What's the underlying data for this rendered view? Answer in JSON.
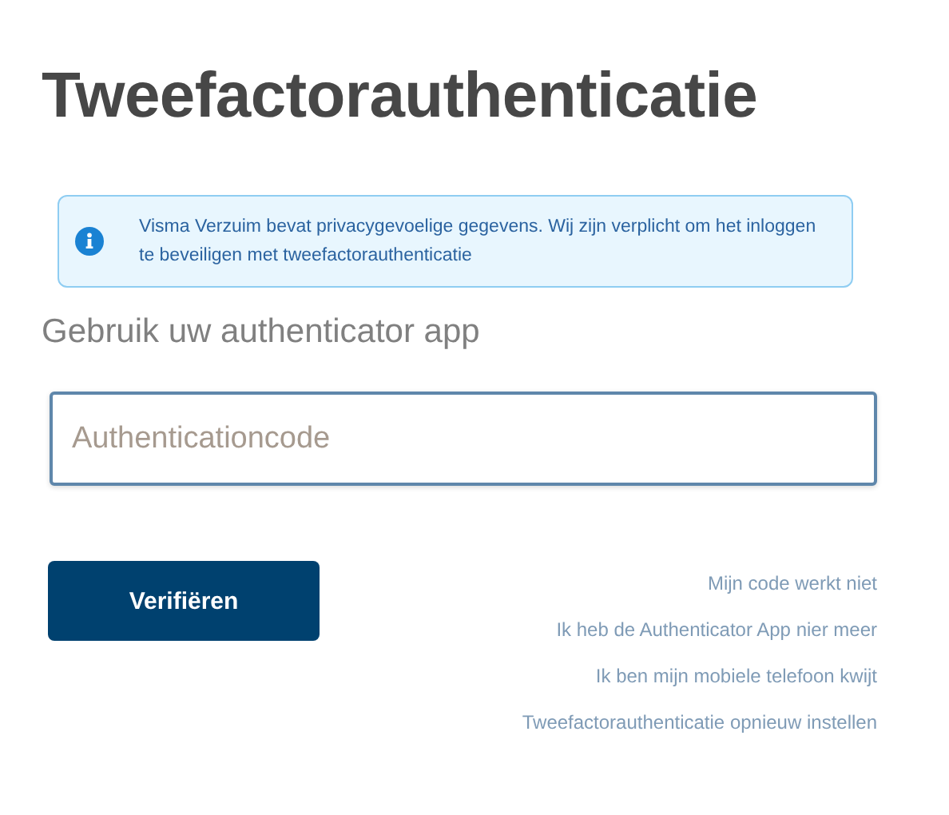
{
  "title": "Tweefactorauthenticatie",
  "notice": {
    "text": "Visma Verzuim bevat privacygevoelige gegevens. Wij zijn verplicht om het inloggen te beveiligen met tweefactorauthenticatie"
  },
  "subtitle": "Gebruik uw authenticator app",
  "code_field": {
    "placeholder": "Authenticationcode"
  },
  "verify_button": "Verifiëren",
  "links": [
    "Mijn code werkt niet",
    "Ik heb de Authenticator App nier meer",
    "Ik ben mijn mobiele telefoon kwijt",
    "Tweefactorauthenticatie opnieuw instellen"
  ]
}
